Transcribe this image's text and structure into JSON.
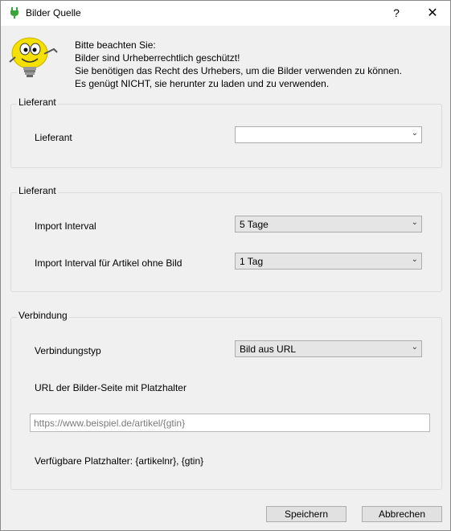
{
  "window": {
    "title": "Bilder Quelle",
    "help_label": "?",
    "close_label": "✕",
    "app_icon": "green-plug-icon"
  },
  "notice": {
    "line1": "Bitte beachten Sie:",
    "line2": "Bilder sind Urheberrechtlich geschützt!",
    "line3": "Sie benötigen das Recht des Urhebers, um die Bilder verwenden zu können.",
    "line4": "Es genügt NICHT, sie herunter zu laden und zu verwenden."
  },
  "group_supplier": {
    "legend": "Lieferant",
    "supplier_label": "Lieferant",
    "supplier_value": ""
  },
  "group_import": {
    "legend": "Lieferant",
    "interval_label": "Import Interval",
    "interval_value": "5 Tage",
    "interval_noimage_label": "Import Interval für Artikel ohne Bild",
    "interval_noimage_value": "1 Tag"
  },
  "group_connection": {
    "legend": "Verbindung",
    "type_label": "Verbindungstyp",
    "type_value": "Bild aus URL",
    "url_label": "URL der Bilder-Seite mit Platzhalter",
    "url_placeholder": "https://www.beispiel.de/artikel/{gtin}",
    "url_value": "",
    "placeholders_text": "Verfügbare Platzhalter: {artikelnr}, {gtin}"
  },
  "buttons": {
    "save": "Speichern",
    "cancel": "Abbrechen"
  },
  "colors": {
    "window_bg": "#f0f0f0",
    "titlebar_bg": "#ffffff",
    "combo_filled_bg": "#e5e5e5",
    "button_bg": "#e1e1e1",
    "icon_green": "#3aa53a",
    "mascot_yellow": "#f5e000"
  }
}
